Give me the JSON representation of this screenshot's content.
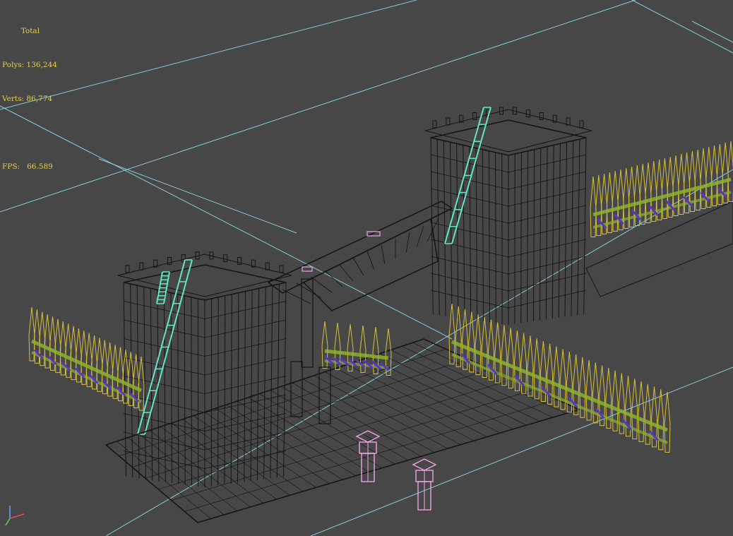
{
  "viewport": {
    "stats": {
      "header": "Total",
      "polys_label": "Polys:",
      "polys_value": "136,244",
      "verts_label": "Verts:",
      "verts_value": "86,774",
      "fps_label": "FPS:",
      "fps_value": "66.589"
    },
    "colors": {
      "background": "#474747",
      "grid": "#8fd7e8",
      "wire_dark": "#141414",
      "wire_teal": "#62e6c8",
      "wire_yellow": "#d8c13a",
      "wire_olive": "#8fb32c",
      "wire_purple": "#5a35c8",
      "wire_pink": "#f2a3e8",
      "stats_text": "#e6d04a"
    },
    "axis_icon": "xyz-axis-tripod-icon"
  }
}
